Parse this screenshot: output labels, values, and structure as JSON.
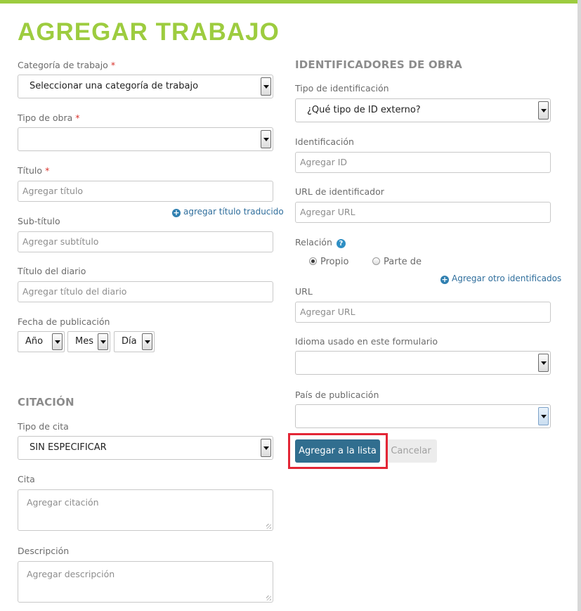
{
  "header": {
    "title": "AGREGAR TRABAJO"
  },
  "left": {
    "category": {
      "label": "Categoría de trabajo",
      "required": "*",
      "value": "Seleccionar una categoría de trabajo"
    },
    "work_type": {
      "label": "Tipo de obra",
      "required": "*",
      "value": ""
    },
    "title_field": {
      "label": "Título",
      "required": "*",
      "placeholder": "Agregar título"
    },
    "translated_link": "agregar título traducido",
    "subtitle": {
      "label": "Sub-título",
      "placeholder": "Agregar subtítulo"
    },
    "journal": {
      "label": "Título del diario",
      "placeholder": "Agregar título del diario"
    },
    "pub_date": {
      "label": "Fecha de publicación",
      "year": "Año",
      "month": "Mes",
      "day": "Día"
    },
    "citation_section": "CITACIÓN",
    "citation_type": {
      "label": "Tipo de cita",
      "value": "SIN ESPECIFICAR"
    },
    "citation": {
      "label": "Cita",
      "placeholder": "Agregar citación"
    },
    "description": {
      "label": "Descripción",
      "placeholder": "Agregar descripción"
    }
  },
  "right": {
    "section": "IDENTIFICADORES DE OBRA",
    "id_type": {
      "label": "Tipo de identificación",
      "value": "¿Qué tipo de ID externo?"
    },
    "identification": {
      "label": "Identificación",
      "placeholder": "Agregar ID"
    },
    "id_url": {
      "label": "URL de identificador",
      "placeholder": "Agregar URL"
    },
    "relation": {
      "label": "Relación",
      "help": "?",
      "option_own": "Propio",
      "option_part": "Parte de",
      "selected": "Propio"
    },
    "add_other_link": "Agregar otro identificados",
    "url": {
      "label": "URL",
      "placeholder": "Agregar URL"
    },
    "language": {
      "label": "Idioma usado en este formulario",
      "value": ""
    },
    "country": {
      "label": "País de publicación",
      "value": ""
    }
  },
  "actions": {
    "add_to_list": "Agregar a la lista",
    "cancel": "Cancelar"
  },
  "colors": {
    "accent": "#9dcc3f",
    "primary_button": "#316e8f",
    "required": "#d9332c",
    "highlight": "#e32636"
  }
}
